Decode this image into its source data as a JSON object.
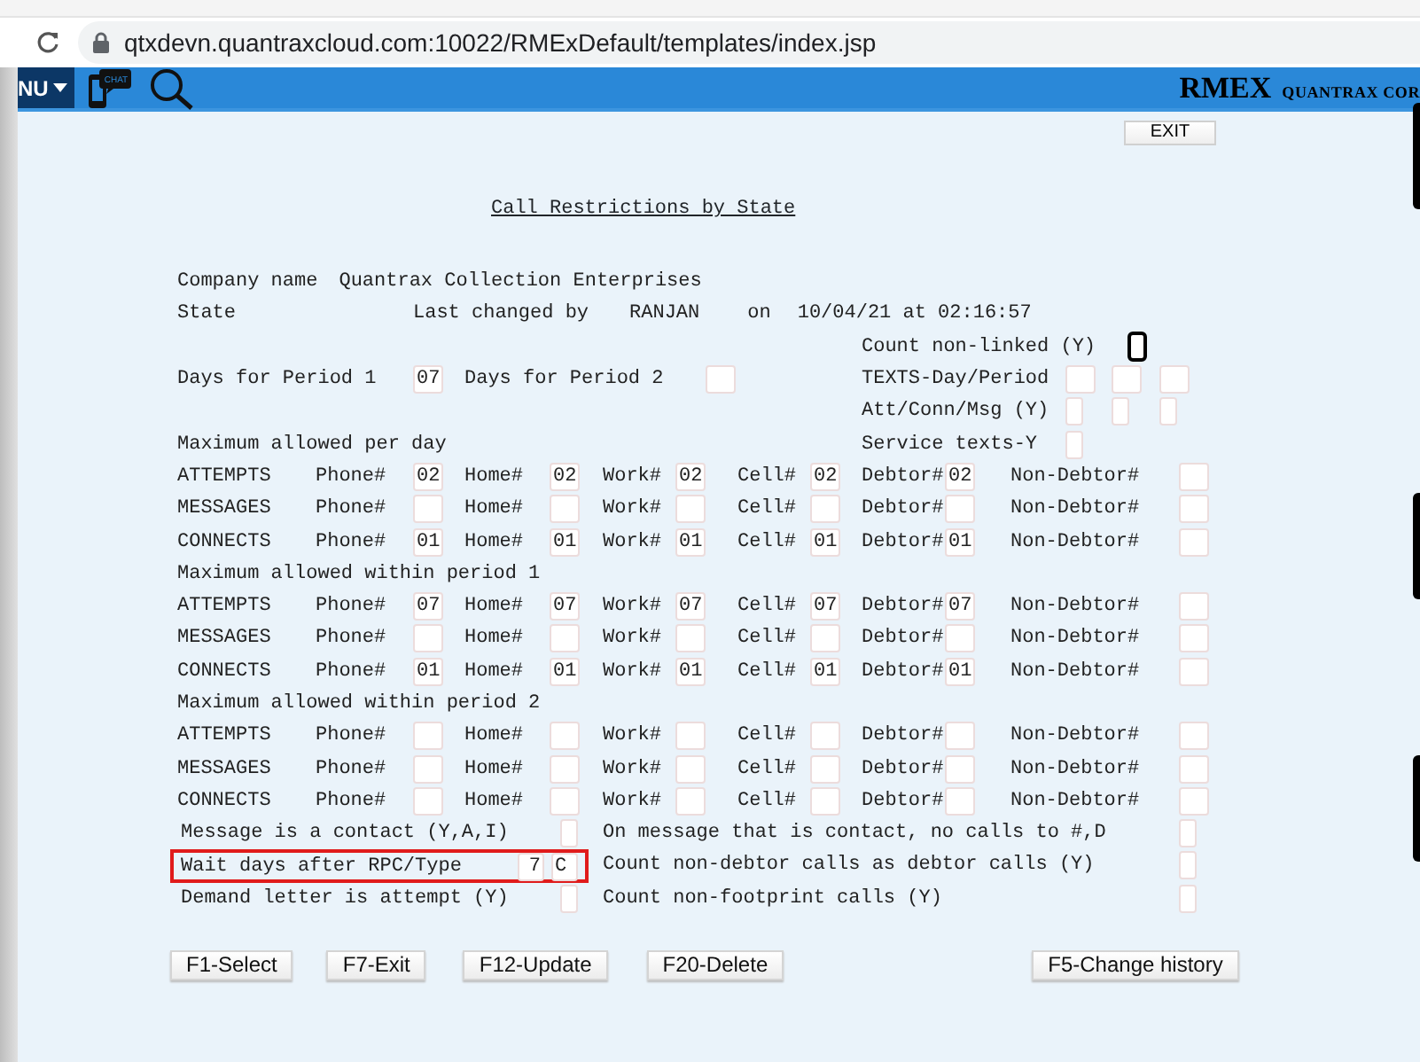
{
  "browser": {
    "url": "qtxdevn.quantraxcloud.com:10022/RMExDefault/templates/index.jsp"
  },
  "header": {
    "menu_label": "NU",
    "chat_label": "CHAT",
    "logo": "RMEX",
    "company": "QUANTRAX COR"
  },
  "exit_button": "EXIT",
  "title": "Call Restrictions by State",
  "company": {
    "label": "Company name",
    "value": "Quantrax Collection Enterprises"
  },
  "state": {
    "label": "State",
    "changed_label": "Last changed by",
    "user": "RANJAN",
    "on_label": "on",
    "timestamp": "10/04/21 at 02:16:57"
  },
  "period_days": [
    {
      "label": "Days for Period 1",
      "value": "07"
    },
    {
      "label": "Days for Period 2"
    }
  ],
  "side_options": [
    {
      "label": "Count non-linked (Y)",
      "kind": "flag",
      "fields": [
        {
          "focused": true
        }
      ]
    },
    {
      "label": "TEXTS-Day/Period",
      "kind": "number",
      "fields": [
        {
          "focused": false
        },
        {
          "focused": false
        },
        {
          "focused": false
        }
      ]
    },
    {
      "label": "Att/Conn/Msg (Y)",
      "kind": "flag",
      "fields": [
        {
          "focused": false
        },
        {
          "focused": false
        },
        {
          "focused": false
        }
      ]
    },
    {
      "label": "Service texts-Y",
      "kind": "flag",
      "fields": [
        {
          "focused": false
        }
      ]
    }
  ],
  "sections": [
    {
      "heading": "Maximum allowed per day",
      "rows": [
        {
          "type": "ATTEMPTS",
          "fields": [
            {
              "label": "Phone#",
              "value": "02"
            },
            {
              "label": "Home#",
              "value": "02"
            },
            {
              "label": "Work#",
              "value": "02"
            },
            {
              "label": "Cell#",
              "value": "02"
            },
            {
              "label": "Debtor#",
              "value": "02"
            },
            {
              "label": "Non-Debtor#"
            }
          ]
        },
        {
          "type": "MESSAGES",
          "fields": [
            {
              "label": "Phone#"
            },
            {
              "label": "Home#"
            },
            {
              "label": "Work#"
            },
            {
              "label": "Cell#"
            },
            {
              "label": "Debtor#"
            },
            {
              "label": "Non-Debtor#"
            }
          ]
        },
        {
          "type": "CONNECTS",
          "fields": [
            {
              "label": "Phone#",
              "value": "01"
            },
            {
              "label": "Home#",
              "value": "01"
            },
            {
              "label": "Work#",
              "value": "01"
            },
            {
              "label": "Cell#",
              "value": "01"
            },
            {
              "label": "Debtor#",
              "value": "01"
            },
            {
              "label": "Non-Debtor#"
            }
          ]
        }
      ]
    },
    {
      "heading": "Maximum allowed within period 1",
      "rows": [
        {
          "type": "ATTEMPTS",
          "fields": [
            {
              "label": "Phone#",
              "value": "07"
            },
            {
              "label": "Home#",
              "value": "07"
            },
            {
              "label": "Work#",
              "value": "07"
            },
            {
              "label": "Cell#",
              "value": "07"
            },
            {
              "label": "Debtor#",
              "value": "07"
            },
            {
              "label": "Non-Debtor#"
            }
          ]
        },
        {
          "type": "MESSAGES",
          "fields": [
            {
              "label": "Phone#"
            },
            {
              "label": "Home#"
            },
            {
              "label": "Work#"
            },
            {
              "label": "Cell#"
            },
            {
              "label": "Debtor#"
            },
            {
              "label": "Non-Debtor#"
            }
          ]
        },
        {
          "type": "CONNECTS",
          "fields": [
            {
              "label": "Phone#",
              "value": "01"
            },
            {
              "label": "Home#",
              "value": "01"
            },
            {
              "label": "Work#",
              "value": "01"
            },
            {
              "label": "Cell#",
              "value": "01"
            },
            {
              "label": "Debtor#",
              "value": "01"
            },
            {
              "label": "Non-Debtor#"
            }
          ]
        }
      ]
    },
    {
      "heading": "Maximum allowed within period 2",
      "rows": [
        {
          "type": "ATTEMPTS",
          "fields": [
            {
              "label": "Phone#"
            },
            {
              "label": "Home#"
            },
            {
              "label": "Work#"
            },
            {
              "label": "Cell#"
            },
            {
              "label": "Debtor#"
            },
            {
              "label": "Non-Debtor#"
            }
          ]
        },
        {
          "type": "MESSAGES",
          "fields": [
            {
              "label": "Phone#"
            },
            {
              "label": "Home#"
            },
            {
              "label": "Work#"
            },
            {
              "label": "Cell#"
            },
            {
              "label": "Debtor#"
            },
            {
              "label": "Non-Debtor#"
            }
          ]
        },
        {
          "type": "CONNECTS",
          "fields": [
            {
              "label": "Phone#"
            },
            {
              "label": "Home#"
            },
            {
              "label": "Work#"
            },
            {
              "label": "Cell#"
            },
            {
              "label": "Debtor#"
            },
            {
              "label": "Non-Debtor#"
            }
          ]
        }
      ]
    }
  ],
  "bottom_rows": [
    {
      "label": "Message is a contact (Y,A,I)",
      "highlighted": false,
      "right_label": "On message that is contact, no calls to #,D"
    },
    {
      "label": "Wait days after RPC/Type",
      "highlighted": true,
      "values": [
        {
          "value": "7"
        },
        {
          "value": "C"
        }
      ],
      "right_label": "Count non-debtor calls as debtor calls (Y)"
    },
    {
      "label": "Demand letter is attempt (Y)",
      "highlighted": false,
      "right_label": "Count non-footprint calls (Y)"
    }
  ],
  "buttons": [
    "F1-Select",
    "F7-Exit",
    "F12-Update",
    "F20-Delete",
    "F5-Change history"
  ]
}
